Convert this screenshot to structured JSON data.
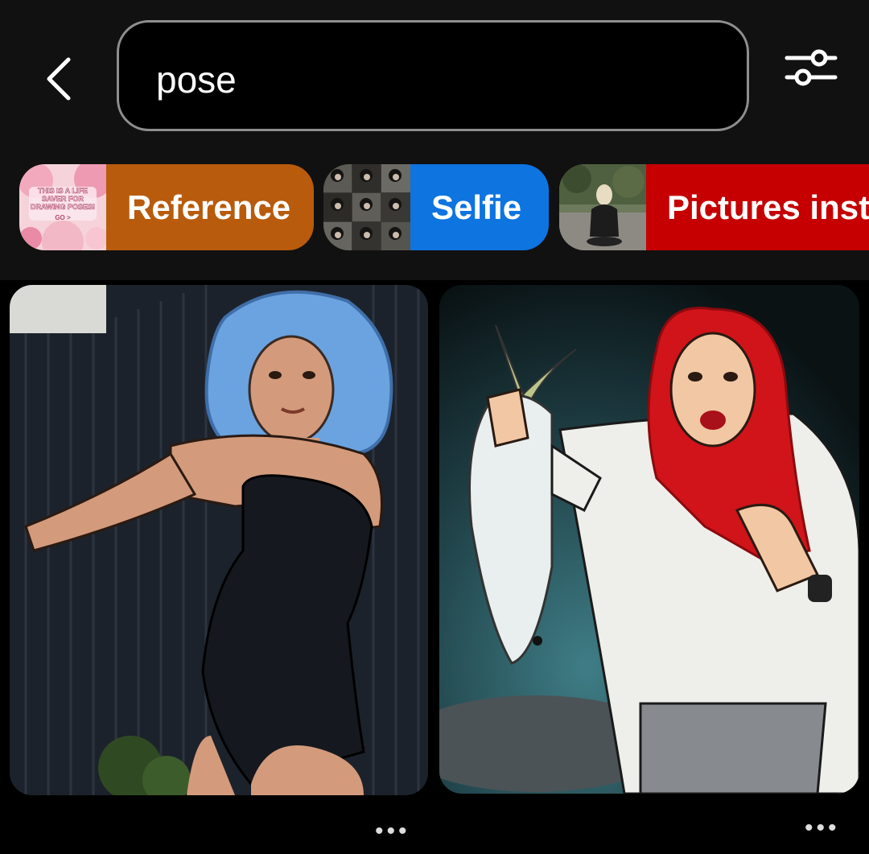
{
  "search": {
    "query": "pose"
  },
  "icons": {
    "back": "chevron-left-icon",
    "filter": "sliders-filter-icon",
    "more": "more-dots-icon"
  },
  "chips": [
    {
      "label": "Reference",
      "color": "#b85b0c",
      "thumb_text": "THIS IS A LIFE SAVER FOR DRAWING POSES!",
      "thumb_sub": "GO >"
    },
    {
      "label": "Selfie",
      "color": "#0d74e0"
    },
    {
      "label": "Pictures insta",
      "color": "#c60000"
    }
  ],
  "pins": [
    {
      "more": "•••"
    },
    {
      "more": "•••"
    }
  ]
}
